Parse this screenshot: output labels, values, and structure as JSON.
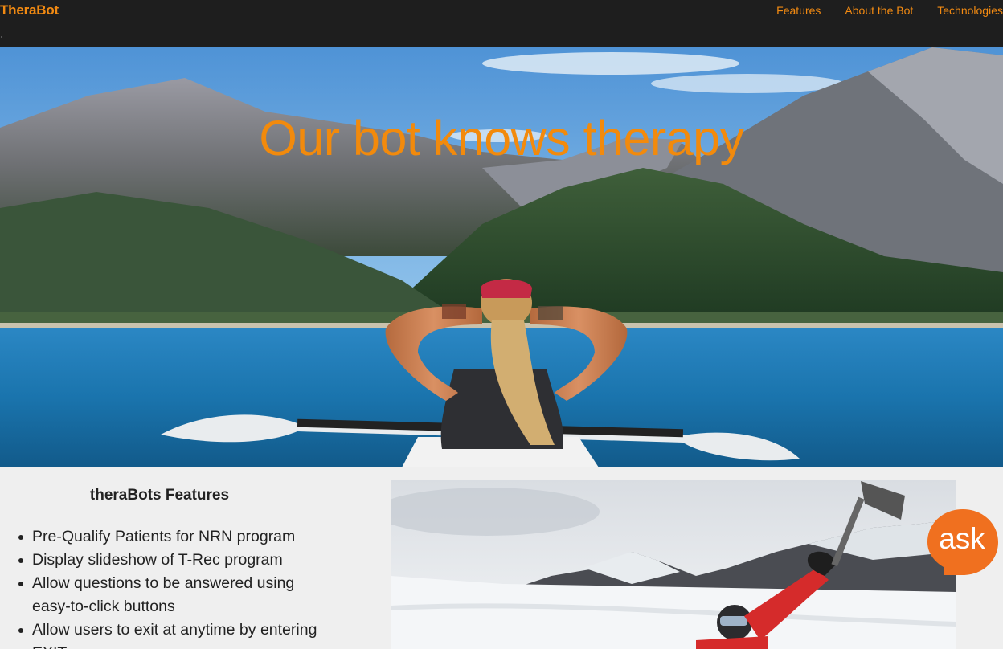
{
  "navbar": {
    "brand": "TheraBot",
    "links": [
      "Features",
      "About the Bot",
      "Technologies"
    ]
  },
  "hero": {
    "title": "Our bot knows therapy"
  },
  "features": {
    "heading": "theraBots Features",
    "items": [
      "Pre-Qualify Patients for NRN program",
      "Display slideshow of T-Rec program",
      "Allow questions to be answered using easy-to-click buttons",
      "Allow users to exit at anytime by entering EXIT"
    ]
  },
  "ask_widget": {
    "label": "ask"
  },
  "colors": {
    "accent": "#f28a12",
    "navbar_bg": "#1e1e1e",
    "page_bg": "#efefef"
  }
}
